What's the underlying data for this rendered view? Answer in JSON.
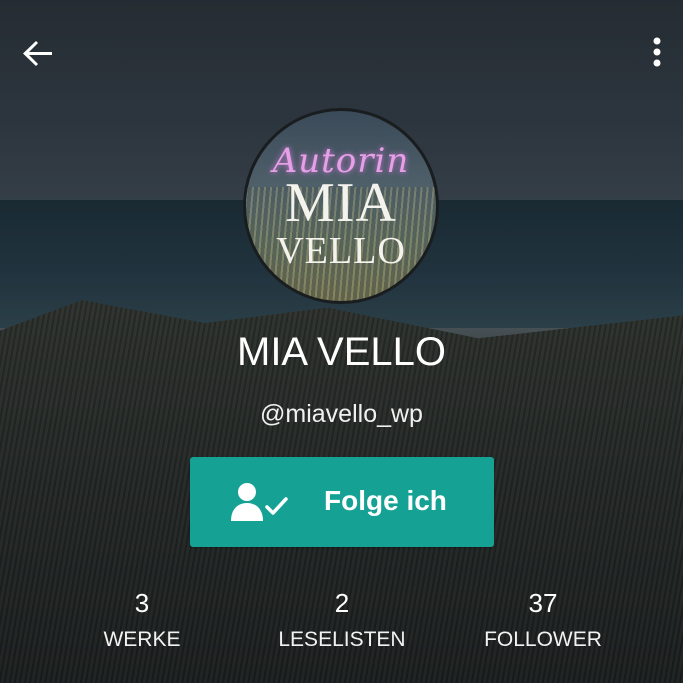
{
  "profile": {
    "avatar_text": {
      "script": "Autorin",
      "line1": "MIA",
      "line2": "VELLO"
    },
    "name": "MIA VELLO",
    "handle": "@miavello_wp"
  },
  "follow_button": {
    "label": "Folge ich",
    "icon": "user-check-icon",
    "color": "#16a195"
  },
  "stats": [
    {
      "value": "3",
      "label": "WERKE"
    },
    {
      "value": "2",
      "label": "LESELISTEN"
    },
    {
      "value": "37",
      "label": "FOLLOWER"
    }
  ],
  "topbar": {
    "back_icon": "arrow-left-icon",
    "menu_icon": "more-vertical-icon"
  }
}
